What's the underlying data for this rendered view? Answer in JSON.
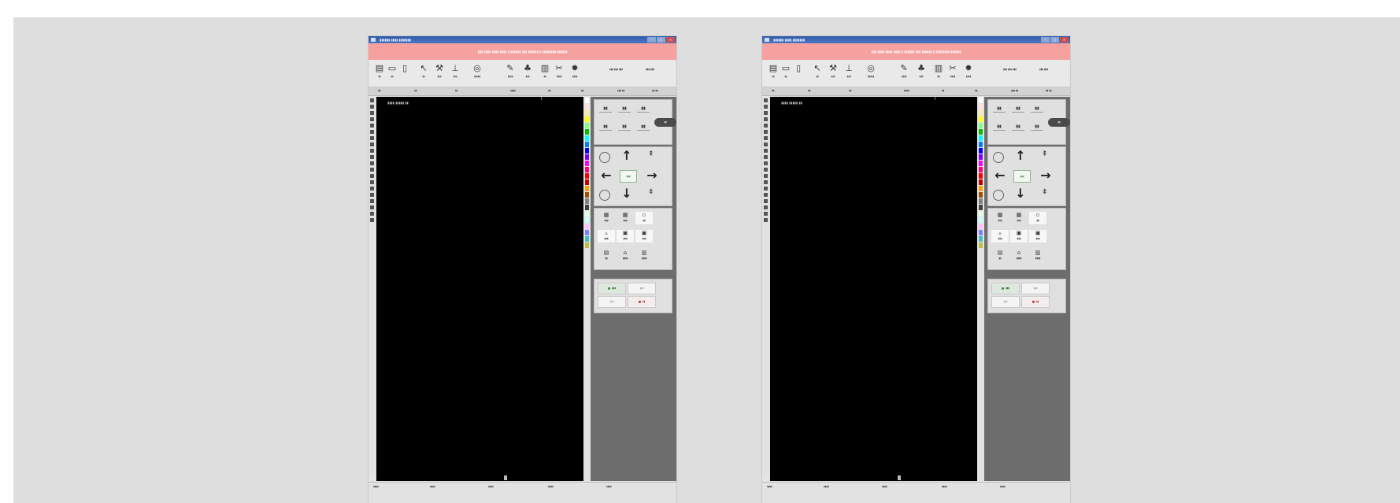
{
  "windows": [
    {
      "id": "left",
      "title": "▮▮▮▮▮▮ ▮▮▮▮ ▮▮▮▮▮▮▮",
      "notice": "▮▮▮ ▮▮▮▮ ▮▮▮▮ ▮▮▮▮ ▮ ▮▮▮▮▮▮ ▮▮▮ ▮▮▮▮▮▮ ▮ ▮▮▮▮▮▮▮▮ ▮▮▮▮▮▮",
      "canvas_caption": "▮▮▮▮ ▮▮▮▮▮ ▮▮",
      "dir_center_label": "▮▮▮",
      "knob_label": "▮▮",
      "status": [
        "▮▮▮▮",
        "▮▮▮▮",
        "▮▮▮▮",
        "▮▮▮▮",
        "▮▮▮▮"
      ]
    },
    {
      "id": "right",
      "title": "▮▮▮▮▮▮ ▮▮▮▮ ▮▮▮▮▮▮▮",
      "notice": "▮▮▮ ▮▮▮▮ ▮▮▮▮ ▮▮▮▮ ▮ ▮▮▮▮▮▮ ▮▮▮ ▮▮▮▮▮▮ ▮ ▮▮▮▮▮▮▮▮ ▮▮▮▮▮▮",
      "canvas_caption": "▮▮▮▮ ▮▮▮▮▮ ▮▮",
      "dir_center_label": "▮▮▮",
      "knob_label": "▮▮",
      "status": [
        "▮▮▮▮",
        "▮▮▮▮",
        "▮▮▮▮",
        "▮▮▮▮",
        "▮▮▮▮"
      ]
    }
  ],
  "toolbar_icons": [
    "save-icon",
    "open-icon",
    "new-icon",
    "pointer-icon",
    "wrench-icon",
    "ruler-icon",
    "settings-icon",
    "brush-icon",
    "layers-icon",
    "image-icon",
    "cut-icon",
    "gear-icon"
  ],
  "palette_colors": [
    "#ffffff",
    "#ffe0e0",
    "#f0f0a0",
    "#ffff00",
    "#80ff80",
    "#00c000",
    "#00ffff",
    "#0080ff",
    "#0000ff",
    "#8000ff",
    "#ff00ff",
    "#ff0080",
    "#ff0000",
    "#c00000",
    "#ffa000",
    "#a05000",
    "#808080",
    "#404040",
    "#e0ffe0",
    "#c0ffff",
    "#ffc0ff",
    "#8080ff",
    "#40c0c0",
    "#c0c040"
  ],
  "colors": {
    "titlebar": "#2f5aa8",
    "notice_bg": "#f7a0a0",
    "canvas_bg": "#000000",
    "panel_bg": "#6d6d6d"
  }
}
